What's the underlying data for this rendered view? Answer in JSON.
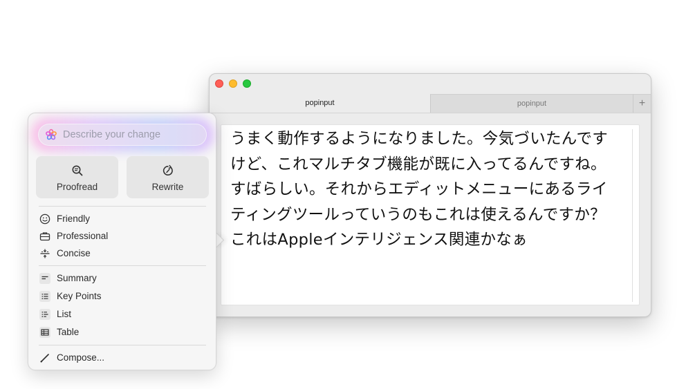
{
  "window": {
    "tabs": [
      {
        "label": "popinput",
        "active": true
      },
      {
        "label": "popinput",
        "active": false
      }
    ],
    "add_tab_label": "+",
    "editor_text": "うまく動作するようになりました。今気づいたんですけど、これマルチタブ機能が既に入ってるんですね。すばらしい。それからエディットメニューにあるライティングツールっていうのもこれは使えるんですか？これはAppleインテリジェンス関連かなぁ"
  },
  "writing_tools": {
    "prompt_placeholder": "Describe your change",
    "actions": [
      {
        "label": "Proofread",
        "icon": "magnifier-check-icon"
      },
      {
        "label": "Rewrite",
        "icon": "rewrite-arrow-icon"
      }
    ],
    "tone_items": [
      {
        "label": "Friendly",
        "icon": "smiley-icon"
      },
      {
        "label": "Professional",
        "icon": "briefcase-icon"
      },
      {
        "label": "Concise",
        "icon": "concise-icon"
      }
    ],
    "format_items": [
      {
        "label": "Summary",
        "icon": "summary-icon"
      },
      {
        "label": "Key Points",
        "icon": "key-points-icon"
      },
      {
        "label": "List",
        "icon": "list-icon"
      },
      {
        "label": "Table",
        "icon": "table-icon"
      }
    ],
    "compose_label": "Compose..."
  },
  "colors": {
    "close": "#ff5f57",
    "minimize": "#febc2e",
    "maximize": "#28c840"
  }
}
